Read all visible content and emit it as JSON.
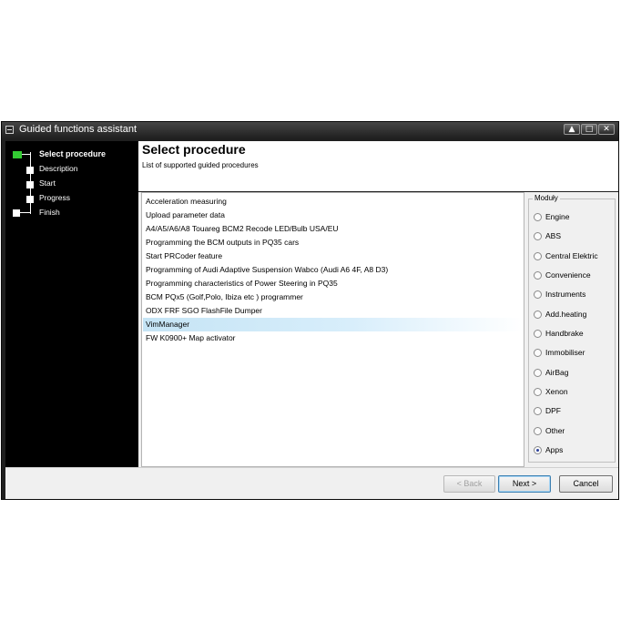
{
  "window": {
    "title": "Guided functions assistant",
    "controls": [
      "▲",
      "□",
      "✕"
    ]
  },
  "sidebar": {
    "steps": [
      {
        "label": "Select procedure",
        "active": true
      },
      {
        "label": "Description"
      },
      {
        "label": "Start"
      },
      {
        "label": "Progress"
      },
      {
        "label": "Finish"
      }
    ]
  },
  "header": {
    "title": "Select procedure",
    "subtitle": "List of supported guided procedures"
  },
  "procedures": {
    "items": [
      "Acceleration measuring",
      "Upload parameter data",
      "A4/A5/A6/A8 Touareg BCM2 Recode LED/Bulb USA/EU",
      "Programming the BCM outputs in PQ35 cars",
      "Start PRCoder feature",
      "Programming of Audi Adaptive Suspension Wabco (Audi A6 4F, A8 D3)",
      "Programming characteristics of Power Steering in PQ35",
      "BCM PQx5 (Golf,Polo, Ibiza etc ) programmer",
      "ODX FRF SGO FlashFile Dumper",
      "VimManager",
      "FW K0900+ Map activator"
    ],
    "selected": "VimManager"
  },
  "modules": {
    "legend": "Moduły",
    "options": [
      "Engine",
      "ABS",
      "Central Elektric",
      "Convenience",
      "Instruments",
      "Add.heating",
      "Handbrake",
      "Immobiliser",
      "AirBag",
      "Xenon",
      "DPF",
      "Other",
      "Apps"
    ],
    "selected": "Apps"
  },
  "footer": {
    "back": "< Back",
    "next": "Next >",
    "cancel": "Cancel"
  }
}
